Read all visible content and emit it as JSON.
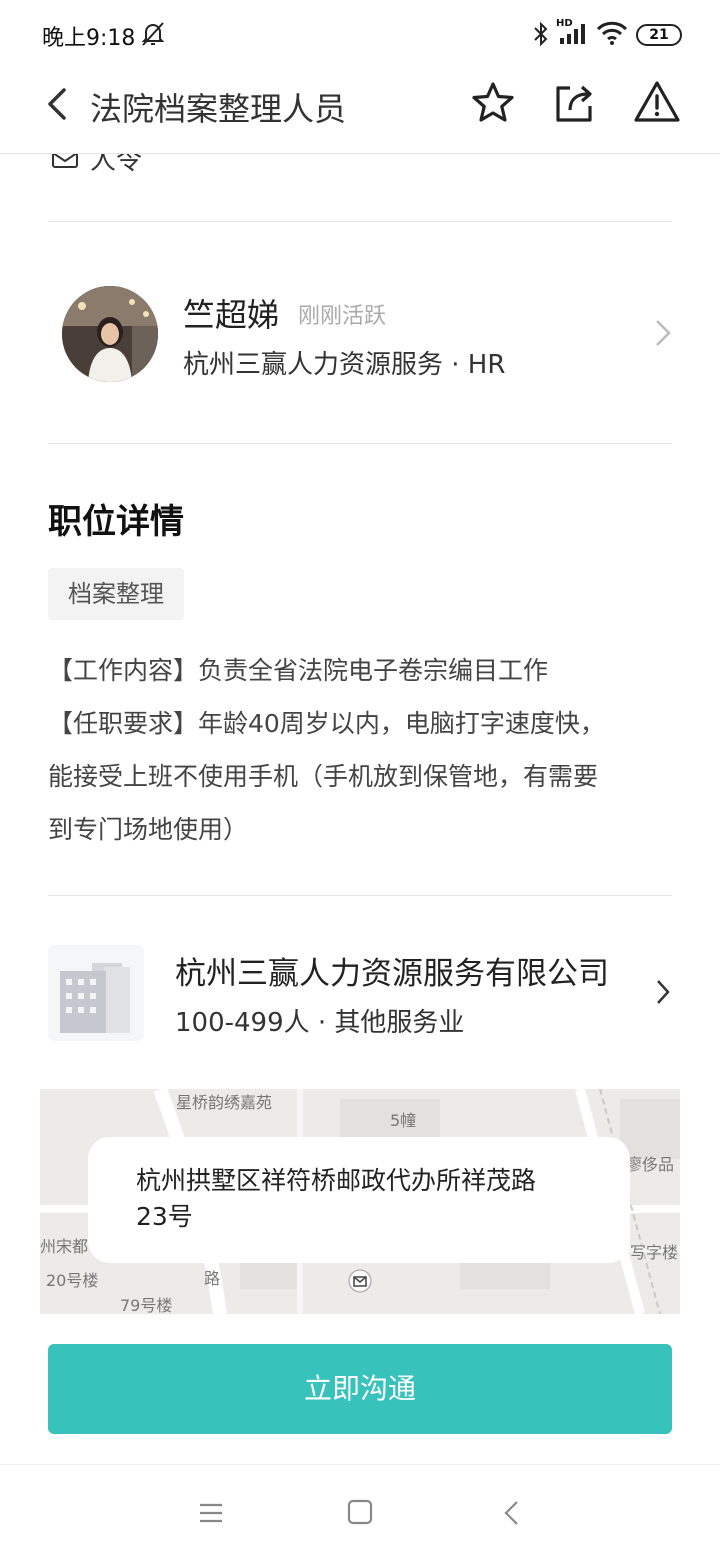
{
  "status_bar": {
    "time": "晚上9:18",
    "network": "HD",
    "battery": "21"
  },
  "header": {
    "title": "法院档案整理人员"
  },
  "cutoff_row": {
    "text": "人令"
  },
  "recruiter": {
    "name": "竺超娣",
    "status": "刚刚活跃",
    "company": "杭州三赢人力资源服务 · HR"
  },
  "job": {
    "section_title": "职位详情",
    "tag": "档案整理",
    "description_lines": [
      "【工作内容】负责全省法院电子卷宗编目工作",
      "【任职要求】年龄40周岁以内，电脑打字速度快，",
      "能接受上班不使用手机（手机放到保管地，有需要",
      "到专门场地使用）"
    ]
  },
  "company": {
    "name": "杭州三赢人力资源服务有限公司",
    "meta": "100-499人 · 其他服务业"
  },
  "map": {
    "address_line1": "杭州拱墅区祥符桥邮政代办所祥茂路",
    "address_line2": "23号",
    "labels": [
      "星桥韵绣嘉苑",
      "5幢",
      "廖侈品",
      "写字楼",
      "州宋都",
      "20号楼",
      "79号楼",
      "路"
    ]
  },
  "cta": {
    "label": "立即沟通"
  },
  "colors": {
    "accent": "#37c2bc",
    "divider": "#e5e5e5"
  }
}
